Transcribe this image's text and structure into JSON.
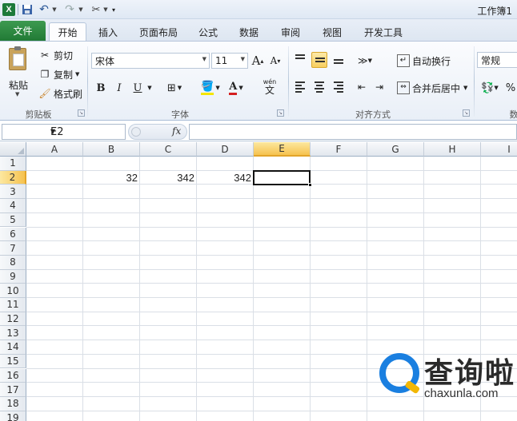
{
  "window": {
    "title": "工作簿1"
  },
  "quick_access": {
    "logo": "X"
  },
  "tabs": [
    {
      "label": "文件"
    },
    {
      "label": "开始"
    },
    {
      "label": "插入"
    },
    {
      "label": "页面布局"
    },
    {
      "label": "公式"
    },
    {
      "label": "数据"
    },
    {
      "label": "审阅"
    },
    {
      "label": "视图"
    },
    {
      "label": "开发工具"
    }
  ],
  "ribbon": {
    "clipboard": {
      "paste": "粘贴",
      "cut": "剪切",
      "copy": "复制",
      "format_painter": "格式刷",
      "group": "剪贴板"
    },
    "font": {
      "name": "宋体",
      "size": "11",
      "grow": "A",
      "shrink": "A",
      "bold": "B",
      "italic": "I",
      "underline": "U",
      "wen": "wén",
      "group": "字体"
    },
    "alignment": {
      "wrap": "自动换行",
      "merge": "合并后居中",
      "group": "对齐方式"
    },
    "number": {
      "format": "常规",
      "percent": "%",
      "group": "数"
    }
  },
  "formula_bar": {
    "name_box": "E2",
    "fx": "fx",
    "value": ""
  },
  "columns": [
    "A",
    "B",
    "C",
    "D",
    "E",
    "F",
    "G",
    "H",
    "I"
  ],
  "active_column": "E",
  "rows": [
    "1",
    "2",
    "3",
    "4",
    "5",
    "6",
    "7",
    "8",
    "9",
    "10",
    "11",
    "12",
    "13",
    "14",
    "15",
    "16",
    "17",
    "18",
    "19"
  ],
  "active_row": "2",
  "cells": {
    "B2": "32",
    "C2": "342",
    "D2": "342"
  },
  "selected_cell": "E2",
  "watermark": {
    "text": "查询啦",
    "sub": "chaxunla.com"
  },
  "colors": {
    "file_tab": "#217a35",
    "selection_header": "#f6c24f",
    "watermark_blue": "#1a7fe0",
    "watermark_yellow": "#f2b705"
  }
}
